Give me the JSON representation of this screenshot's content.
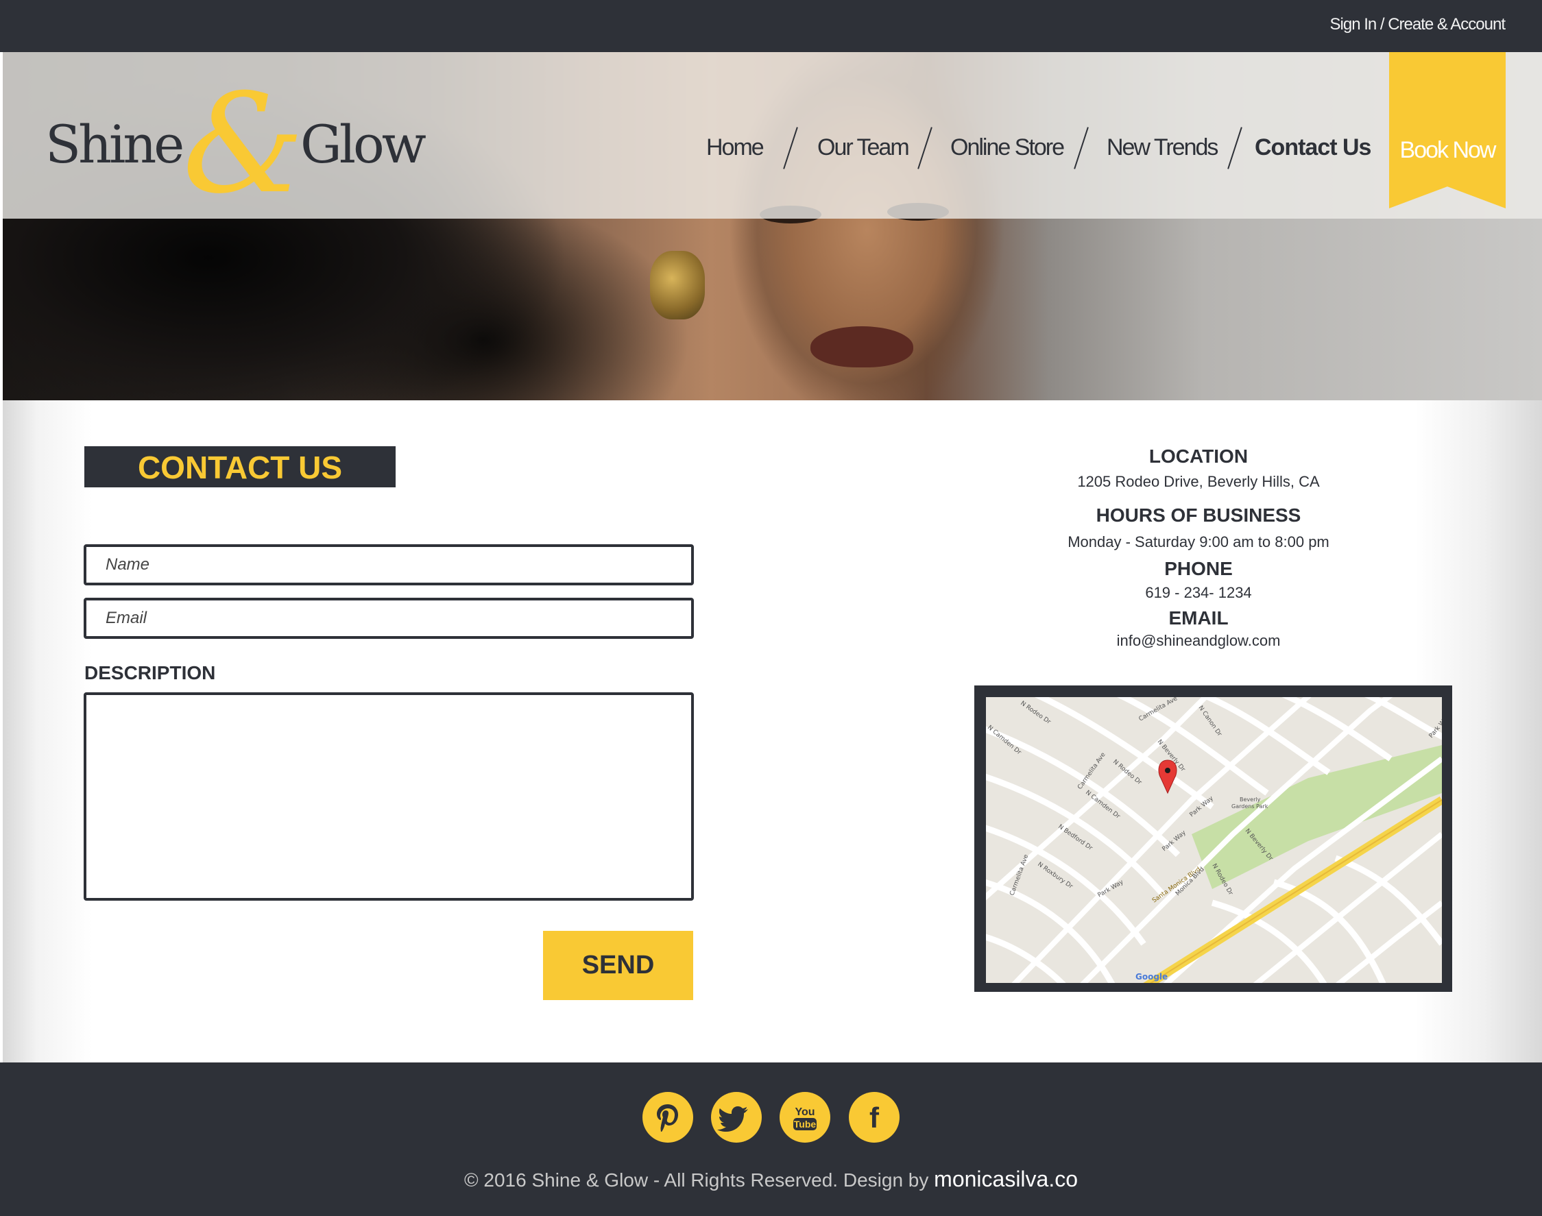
{
  "topbar": {
    "signin_label": "Sign In / Create & Account"
  },
  "brand": {
    "word1": "Shine",
    "ampersand": "&",
    "word2": "Glow"
  },
  "nav": {
    "items": [
      {
        "label": "Home"
      },
      {
        "label": "Our Team"
      },
      {
        "label": "Online Store"
      },
      {
        "label": "New Trends"
      },
      {
        "label": "Contact Us",
        "active": true
      }
    ],
    "book_now": "Book Now"
  },
  "contact": {
    "heading": "CONTACT US",
    "name_placeholder": "Name",
    "email_placeholder": "Email",
    "description_label": "DESCRIPTION",
    "send_label": "SEND"
  },
  "info": {
    "location_title": "LOCATION",
    "location_value": "1205 Rodeo Drive, Beverly Hills, CA",
    "hours_title": "HOURS OF BUSINESS",
    "hours_value": "Monday - Saturday  9:00 am to 8:00 pm",
    "phone_title": "PHONE",
    "phone_value": "619 - 234- 1234",
    "email_title": "EMAIL",
    "email_value": "info@shineandglow.com"
  },
  "map": {
    "streets": [
      "N Rodeo Dr",
      "Carmelita Ave",
      "N Canon Dr",
      "N Camden Dr",
      "N Beverly Dr",
      "Park Way",
      "Carmelita Ave",
      "N Rodeo Dr",
      "N Camden Dr",
      "Beverly Gardens Park",
      "N Bedford Dr",
      "Park Way",
      "Park Way",
      "N Beverly Dr",
      "N Roxbury Dr",
      "Carmelita Ave",
      "Santa Monica Blvd",
      "N Rodeo Dr",
      "Monica Blvd",
      "Park Way"
    ],
    "brand": "Google"
  },
  "footer": {
    "social": [
      "pinterest-icon",
      "twitter-icon",
      "youtube-icon",
      "facebook-icon"
    ],
    "youtube_text": [
      "You",
      "Tube"
    ],
    "facebook_glyph": "f",
    "copyright": "© 2016 Shine & Glow - All Rights Reserved. Design by ",
    "credit": "monicasilva.co"
  },
  "colors": {
    "dark": "#2e3138",
    "accent": "#f9c934",
    "map_park": "#c7dfa6",
    "map_road": "#ffffff",
    "pin": "#e53935"
  }
}
